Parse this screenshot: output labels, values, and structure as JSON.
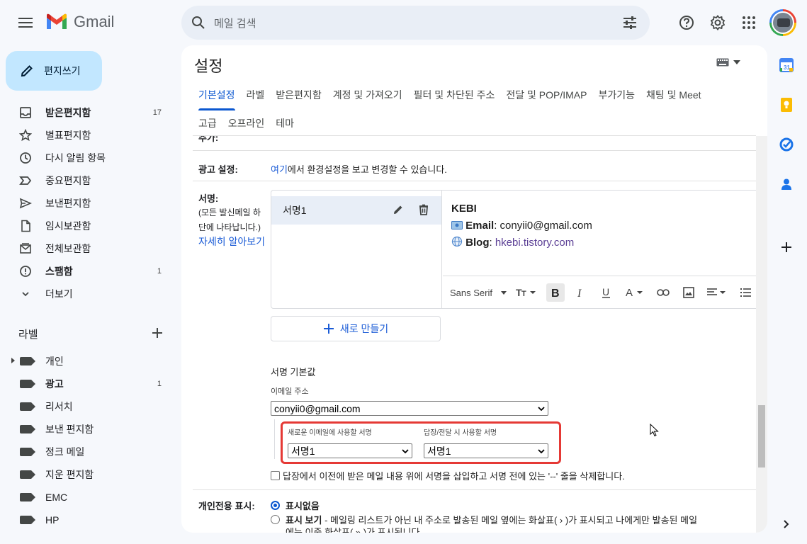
{
  "app": {
    "name": "Gmail"
  },
  "search": {
    "placeholder": "메일 검색"
  },
  "compose": {
    "label": "편지쓰기"
  },
  "nav": {
    "items": [
      {
        "label": "받은편지함",
        "count": "17",
        "bold": true,
        "icon": "inbox-icon"
      },
      {
        "label": "별표편지함",
        "count": "",
        "bold": false,
        "icon": "star-icon"
      },
      {
        "label": "다시 알림 항목",
        "count": "",
        "bold": false,
        "icon": "clock-icon"
      },
      {
        "label": "중요편지함",
        "count": "",
        "bold": false,
        "icon": "important-icon"
      },
      {
        "label": "보낸편지함",
        "count": "",
        "bold": false,
        "icon": "send-icon"
      },
      {
        "label": "임시보관함",
        "count": "",
        "bold": false,
        "icon": "draft-icon"
      },
      {
        "label": "전체보관함",
        "count": "",
        "bold": false,
        "icon": "all-mail-icon"
      },
      {
        "label": "스팸함",
        "count": "1",
        "bold": true,
        "icon": "spam-icon"
      },
      {
        "label": "더보기",
        "count": "",
        "bold": false,
        "icon": "chevron-down-icon"
      }
    ]
  },
  "labels": {
    "heading": "라벨",
    "items": [
      {
        "label": "개인",
        "count": "",
        "bold": false
      },
      {
        "label": "광고",
        "count": "1",
        "bold": true
      },
      {
        "label": "리서치",
        "count": "",
        "bold": false
      },
      {
        "label": "보낸 편지함",
        "count": "",
        "bold": false
      },
      {
        "label": "정크 메일",
        "count": "",
        "bold": false
      },
      {
        "label": "지운 편지함",
        "count": "",
        "bold": false
      },
      {
        "label": "EMC",
        "count": "",
        "bold": false
      },
      {
        "label": "HP",
        "count": "",
        "bold": false
      }
    ]
  },
  "settings": {
    "title": "설정",
    "tabs_row1": [
      "기본설정",
      "라벨",
      "받은편지함",
      "계정 및 가져오기",
      "필터 및 차단된 주소",
      "전달 및 POP/IMAP",
      "부가기능",
      "채팅 및 Meet"
    ],
    "tabs_row2": [
      "고급",
      "오프라인",
      "테마"
    ],
    "active_tab": "기본설정",
    "cut_label": "추가:",
    "ads": {
      "label": "광고 설정:",
      "link": "여기",
      "text": "에서 환경설정을 보고 변경할 수 있습니다."
    },
    "signature": {
      "label": "서명:",
      "desc_line1": "(모든 발신메일 하",
      "desc_line2": "단에 나타납니다.)",
      "learn_more": "자세히 알아보기",
      "item_name": "서명1",
      "content": {
        "name": "KEBI",
        "email_label": "Email",
        "email_value": "conyii0@gmail.com",
        "blog_label": "Blog",
        "blog_value": "hkebi.tistory.com"
      },
      "toolbar": {
        "font": "Sans Serif"
      },
      "new_button": "새로 만들기",
      "defaults": {
        "heading": "서명 기본값",
        "email_label": "이메일 주소",
        "email_value": "conyii0@gmail.com",
        "new_label": "새로운 이메일에 사용할 서명",
        "new_value": "서명1",
        "reply_label": "답장/전달 시 사용할 서명",
        "reply_value": "서명1",
        "checkbox_text": "답장에서 이전에 받은 메일 내용 위에 서명을 삽입하고 서명 전에 있는 '--' 줄을 삭제합니다."
      }
    },
    "personal": {
      "label": "개인전용 표시:",
      "opt1": "표시없음",
      "opt2_bold": "표시 보기",
      "opt2_text": " - 메일링 리스트가 아닌 내 주소로 발송된 메일 옆에는 화살표( › )가 표시되고 나에게만 발송된 메일",
      "opt2_line2": "에는 이중 화살표( » )가 표시됩니다."
    }
  }
}
